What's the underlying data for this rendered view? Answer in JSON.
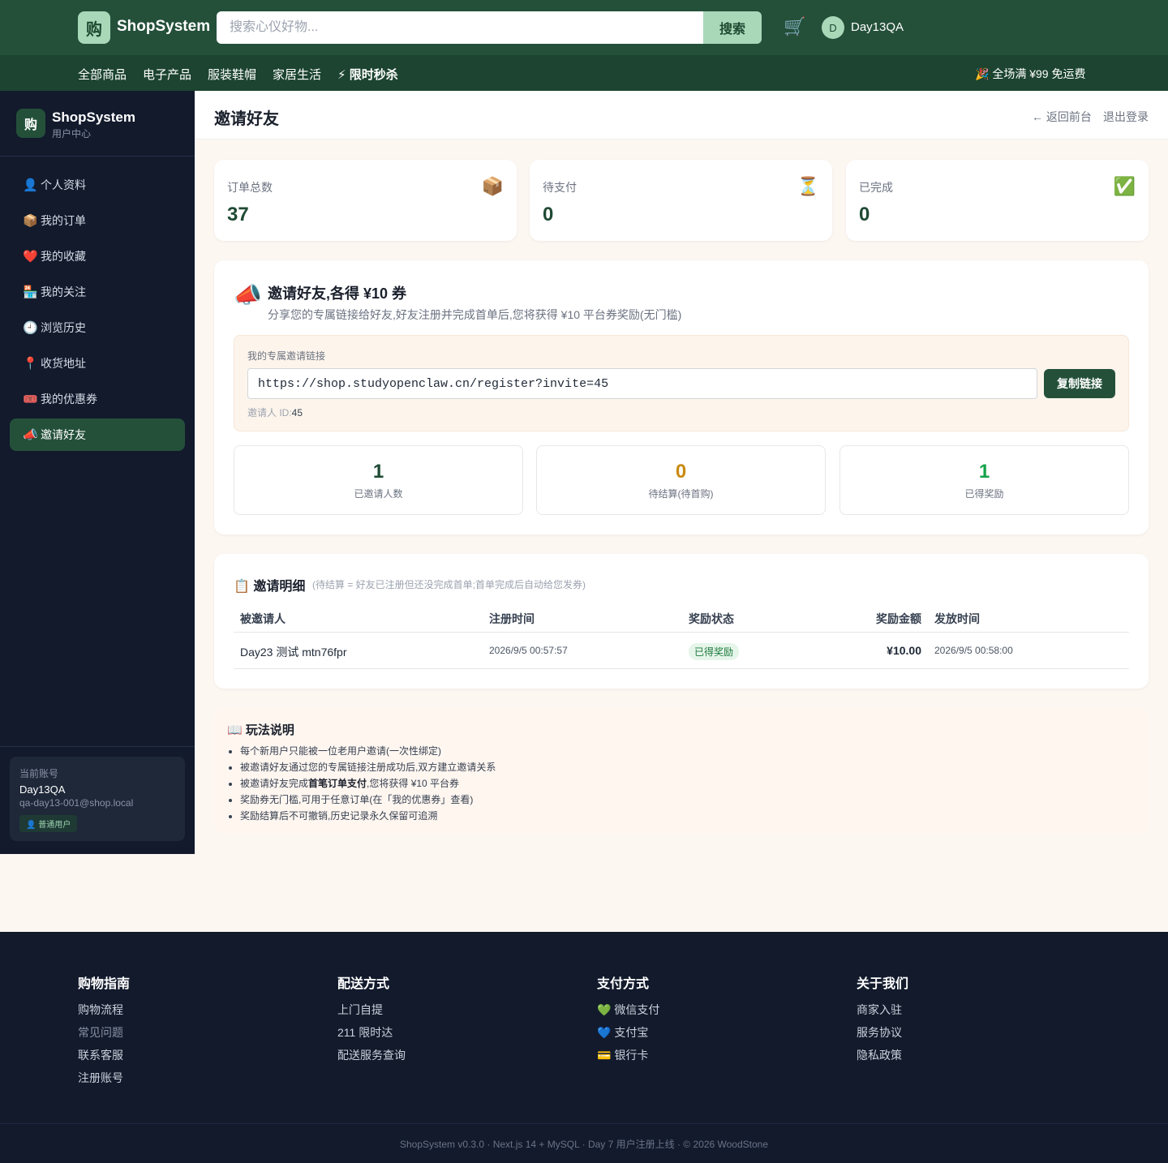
{
  "header": {
    "logo_char": "购",
    "brand": "ShopSystem",
    "search_placeholder": "搜索心仪好物...",
    "search_button": "搜索",
    "user_initial": "D",
    "user_name": "Day13QA"
  },
  "categories": [
    "全部商品",
    "电子产品",
    "服装鞋帽",
    "家居生活",
    "⚡ 限时秒杀"
  ],
  "promo": "🎉 全场满 ¥99 免运费",
  "sidebar": {
    "logo_char": "购",
    "brand": "ShopSystem",
    "subtitle": "用户中心",
    "items": [
      {
        "icon": "👤",
        "label": "个人资料"
      },
      {
        "icon": "📦",
        "label": "我的订单"
      },
      {
        "icon": "❤️",
        "label": "我的收藏"
      },
      {
        "icon": "🏪",
        "label": "我的关注"
      },
      {
        "icon": "🕘",
        "label": "浏览历史"
      },
      {
        "icon": "📍",
        "label": "收货地址"
      },
      {
        "icon": "🎟️",
        "label": "我的优惠券"
      },
      {
        "icon": "📣",
        "label": "邀请好友"
      }
    ],
    "active_index": 7,
    "account": {
      "label": "当前账号",
      "name": "Day13QA",
      "email": "qa-day13-001@shop.local",
      "role": "👤 普通用户"
    }
  },
  "main": {
    "title": "邀请好友",
    "back_link": "← 返回前台",
    "logout": "退出登录",
    "stats": [
      {
        "label": "订单总数",
        "value": "37",
        "icon": "📦"
      },
      {
        "label": "待支付",
        "value": "0",
        "icon": "⏳"
      },
      {
        "label": "已完成",
        "value": "0",
        "icon": "✅"
      }
    ],
    "invite": {
      "icon": "📣",
      "title": "邀请好友,各得 ¥10 券",
      "description": "分享您的专属链接给好友,好友注册并完成首单后,您将获得 ¥10 平台券奖励(无门槛)",
      "link_label": "我的专属邀请链接",
      "link": "https://shop.studyopenclaw.cn/register?invite=45",
      "copy_button": "复制链接",
      "inviter_label": "邀请人 ID:",
      "inviter_id": "45",
      "mini_stats": [
        {
          "value": "1",
          "label": "已邀请人数",
          "color": "#1f4a33"
        },
        {
          "value": "0",
          "label": "待结算(待首购)",
          "color": "#c98a10"
        },
        {
          "value": "1",
          "label": "已得奖励",
          "color": "#16a34a"
        }
      ]
    },
    "details": {
      "title": "📋 邀请明细",
      "note": "(待结算 = 好友已注册但还没完成首单;首单完成后自动给您发券)",
      "columns": [
        "被邀请人",
        "注册时间",
        "奖励状态",
        "奖励金额",
        "发放时间"
      ],
      "rows": [
        {
          "invitee": "Day23 测试 mtn76fpr",
          "registered": "2026/9/5 00:57:57",
          "status": "已得奖励",
          "amount": "¥10.00",
          "issued": "2026/9/5 00:58:00"
        }
      ]
    },
    "rules": {
      "title": "📖 玩法说明",
      "items": [
        {
          "pre": "每个新用户只能被一位老用户邀请(一次性绑定)",
          "bold": "",
          "post": ""
        },
        {
          "pre": "被邀请好友通过您的专属链接注册成功后,双方建立邀请关系",
          "bold": "",
          "post": ""
        },
        {
          "pre": "被邀请好友完成",
          "bold": "首笔订单支付",
          "post": ",您将获得 ¥10 平台券"
        },
        {
          "pre": "奖励券无门槛,可用于任意订单(在「我的优惠券」查看)",
          "bold": "",
          "post": ""
        },
        {
          "pre": "奖励结算后不可撤销,历史记录永久保留可追溯",
          "bold": "",
          "post": ""
        }
      ]
    }
  },
  "footer": {
    "columns": [
      {
        "title": "购物指南",
        "links": [
          "购物流程",
          "常见问题",
          "联系客服",
          "注册账号"
        ]
      },
      {
        "title": "配送方式",
        "links": [
          "上门自提",
          "211 限时达",
          "配送服务查询"
        ]
      },
      {
        "title": "支付方式",
        "links": [
          "💚 微信支付",
          "💙 支付宝",
          "💳 银行卡"
        ]
      },
      {
        "title": "关于我们",
        "links": [
          "商家入驻",
          "服务协议",
          "隐私政策"
        ]
      }
    ],
    "copyright": "ShopSystem v0.3.0 · Next.js 14 + MySQL · Day 7 用户注册上线 · © 2026 WoodStone"
  }
}
